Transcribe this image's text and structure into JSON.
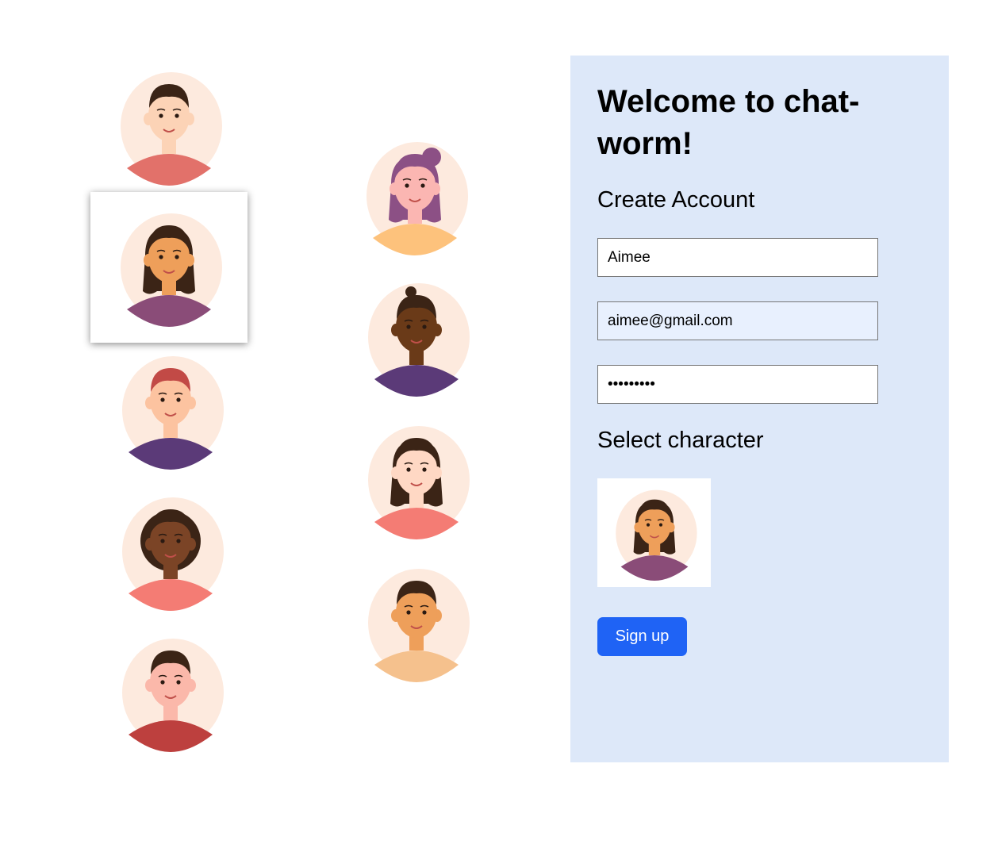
{
  "characters": [
    {
      "name": "boy-red-hoodie",
      "hair": "#3b2416",
      "skin": "#fcd3b6",
      "shirt": "#e2716a",
      "selected": false
    },
    {
      "name": "girl-purple-top",
      "hair": "#3b2416",
      "skin": "#ee9f5a",
      "shirt": "#8a4c78",
      "selected": true
    },
    {
      "name": "boy-red-hair",
      "hair": "#c24a46",
      "skin": "#fcc3a0",
      "shirt": "#5b3a78",
      "selected": false
    },
    {
      "name": "girl-curly-hair",
      "hair": "#3b2416",
      "skin": "#7b4426",
      "shirt": "#f47c74",
      "selected": false
    },
    {
      "name": "boy-striped-shirt",
      "hair": "#3b2416",
      "skin": "#fbb8aa",
      "shirt": "#bd403e",
      "selected": false
    },
    {
      "name": "girl-bun",
      "hair": "#8c5085",
      "skin": "#fbb6b2",
      "shirt": "#fdc27c",
      "selected": false
    },
    {
      "name": "boy-turtleneck",
      "hair": "#3b2416",
      "skin": "#6a3a18",
      "shirt": "#5b3a78",
      "selected": false
    },
    {
      "name": "girl-overalls",
      "hair": "#3b2416",
      "skin": "#ffd8c4",
      "shirt": "#f47c74",
      "selected": false
    },
    {
      "name": "boy-vest",
      "hair": "#3b2416",
      "skin": "#ee9f5a",
      "shirt": "#f5c18d",
      "selected": false
    }
  ],
  "form": {
    "title": "Welcome to chat-worm!",
    "subtitle": "Create Account",
    "username_value": "Aimee",
    "email_value": "aimee@gmail.com",
    "password_value": "123456789",
    "select_label": "Select character",
    "signup_label": "Sign up"
  },
  "colors": {
    "panel_bg": "#dde8f9",
    "button_bg": "#1f63f5",
    "avatar_backdrop": "#fdeade"
  }
}
